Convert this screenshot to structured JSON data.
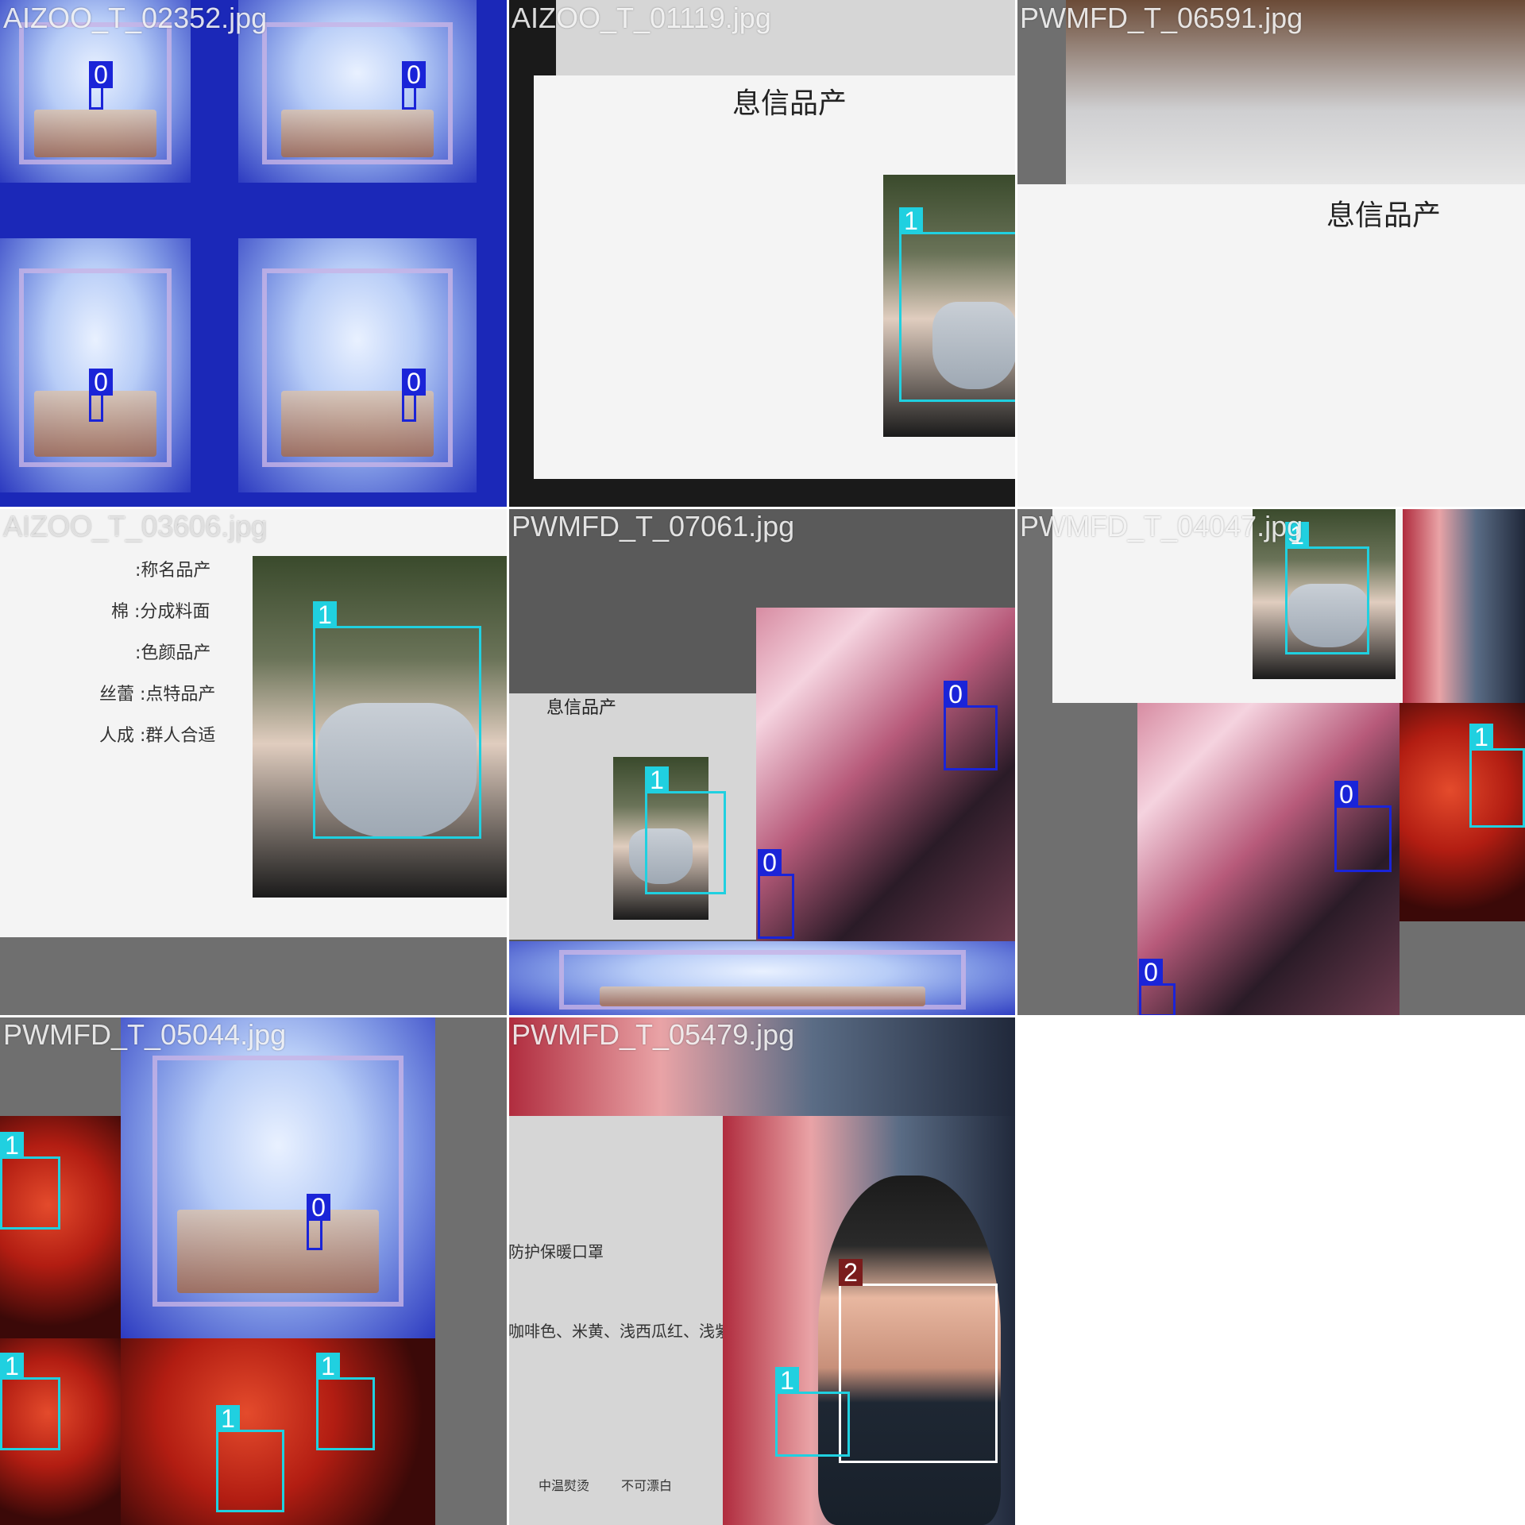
{
  "colors": {
    "class_0": "#1a24d8",
    "class_1": "#20d0e0",
    "class_2": "#ffffff",
    "label_2_bg": "#7a1c1c",
    "tile_background": "#6f6f6f"
  },
  "tiles": [
    {
      "filename": "AIZOO_T_02352.jpg",
      "boxes": [
        {
          "cls": "0"
        },
        {
          "cls": "0"
        },
        {
          "cls": "0"
        },
        {
          "cls": "0"
        }
      ]
    },
    {
      "filename": "AIZOO_T_01119.jpg",
      "doc_title": "息信品产",
      "boxes": [
        {
          "cls": "1"
        }
      ]
    },
    {
      "filename": "PWMFD_T_06591.jpg",
      "doc_title": "息信品产",
      "boxes": []
    },
    {
      "filename": "AIZOO_T_03606.jpg",
      "doc_rows": [
        ":称名品产",
        "棉 :分成料面",
        ":色颜品产",
        "丝蕾 :点特品产",
        "人成 :群人合适"
      ],
      "boxes": [
        {
          "cls": "1"
        }
      ]
    },
    {
      "filename": "PWMFD_T_07061.jpg",
      "doc_title": "息信品产",
      "boxes": [
        {
          "cls": "1"
        },
        {
          "cls": "0"
        },
        {
          "cls": "0"
        }
      ]
    },
    {
      "filename": "PWMFD_T_04047.jpg",
      "boxes": [
        {
          "cls": "1"
        },
        {
          "cls": "1"
        },
        {
          "cls": "0"
        },
        {
          "cls": "0"
        }
      ]
    },
    {
      "filename": "PWMFD_T_05044.jpg",
      "boxes": [
        {
          "cls": "1"
        },
        {
          "cls": "0"
        },
        {
          "cls": "1"
        },
        {
          "cls": "1"
        },
        {
          "cls": "1"
        }
      ]
    },
    {
      "filename": "PWMFD_T_05479.jpg",
      "doc_rows": [
        "防护保暖口罩",
        "咖啡色、米黄、浅西瓜红、浅紫",
        "中温熨烫",
        "不可漂白"
      ],
      "boxes": [
        {
          "cls": "2"
        },
        {
          "cls": "1"
        }
      ]
    }
  ]
}
